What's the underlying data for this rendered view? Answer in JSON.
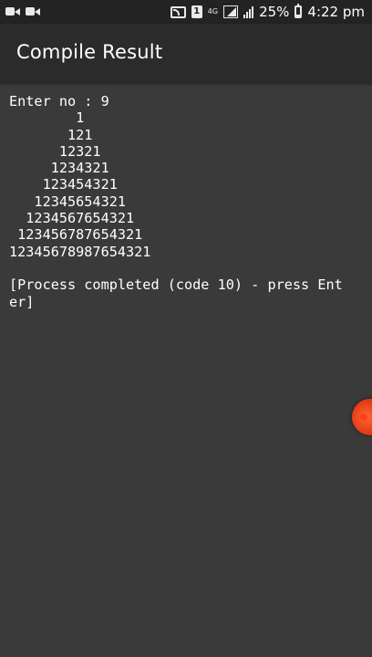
{
  "status_bar": {
    "network_type": "4G",
    "sim_slot": "1",
    "battery_percent": "25%",
    "time": "4:22 pm"
  },
  "app_bar": {
    "title": "Compile Result"
  },
  "console": {
    "lines": [
      "Enter no : 9",
      "        1",
      "       121",
      "      12321",
      "     1234321",
      "    123454321",
      "   12345654321",
      "  1234567654321",
      " 123456787654321",
      "12345678987654321",
      "",
      "[Process completed (code 10) - press Ent",
      "er]"
    ]
  }
}
